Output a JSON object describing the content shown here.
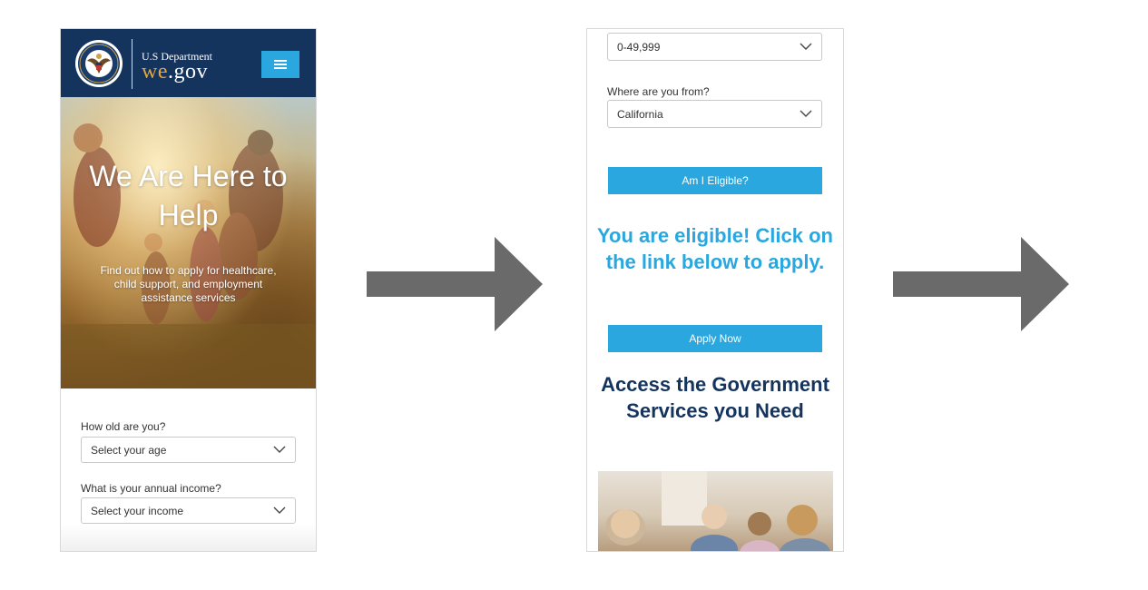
{
  "screen1": {
    "brand": {
      "department": "U.S Department",
      "name_accent": "we",
      "name_rest": ".gov"
    },
    "menu_icon": "hamburger-menu-icon",
    "hero": {
      "title": "We Are Here to Help",
      "subtitle": "Find out how to apply for healthcare, child support, and employment assistance services"
    },
    "form": {
      "age_label": "How old are you?",
      "age_value": "Select your age",
      "income_label": "What is your annual income?",
      "income_value": "Select your income"
    }
  },
  "screen2": {
    "income_value": "0-49,999",
    "location_label": "Where are you from?",
    "location_value": "California",
    "eligibility_button": "Am I Eligible?",
    "eligible_message": "You are eligible! Click on the link below to apply.",
    "apply_button": "Apply Now",
    "services_heading": "Access the Government Services you Need"
  },
  "colors": {
    "navy": "#14345e",
    "accent_blue": "#29a7de",
    "gold": "#e3a73b",
    "arrow_gray": "#6a6a6a"
  },
  "icons": [
    "seal-logo-icon",
    "hamburger-menu-icon",
    "chevron-down-icon",
    "right-arrow-icon"
  ]
}
